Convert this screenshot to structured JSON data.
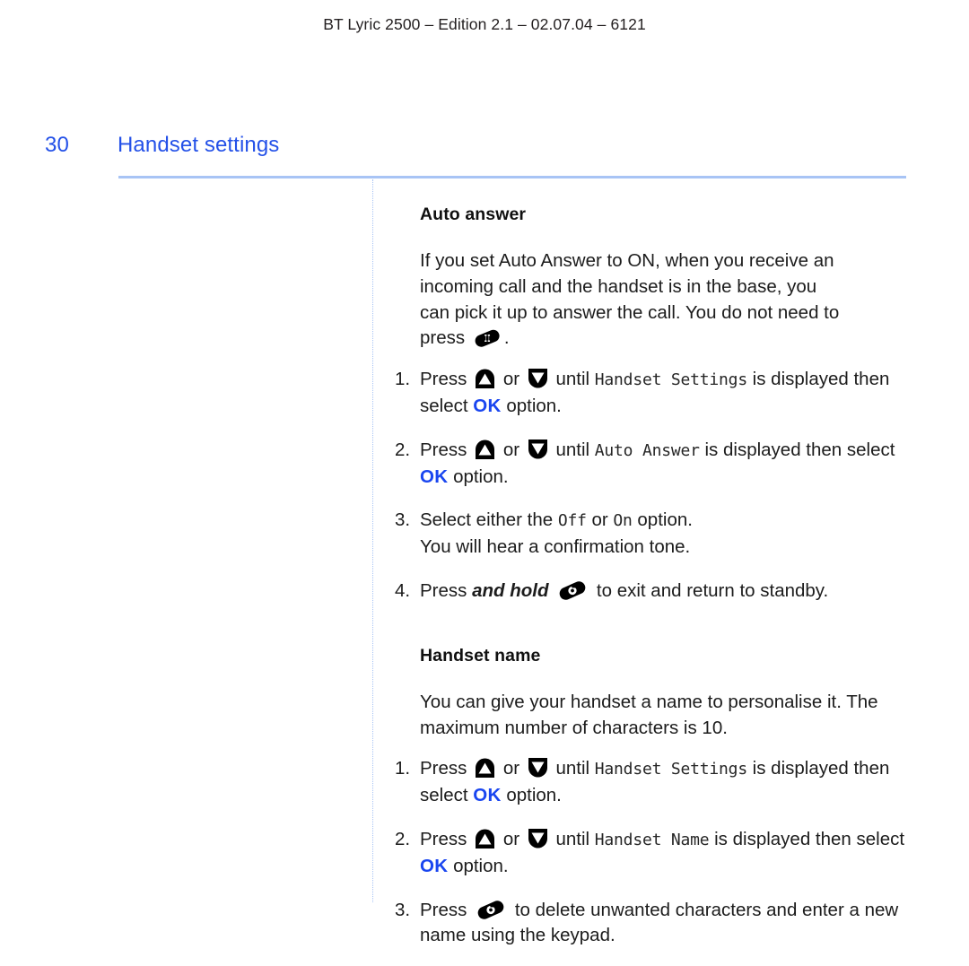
{
  "header": {
    "running_head": "BT Lyric 2500 – Edition 2.1 – 02.07.04 – 6121"
  },
  "page": {
    "number": "30",
    "section_title": "Handset settings",
    "accent_blue": "#2451e8",
    "rule_blue": "#a8c4f5",
    "ok_blue": "#1a46f0"
  },
  "sections": [
    {
      "heading": "Auto answer",
      "intro_line1": "If you set Auto Answer to ON, when you receive an",
      "intro_line2": "incoming call and the handset is in the base, you",
      "intro_line3": "can pick it up to answer the call.  You do not need to",
      "intro_line4_pre": "press",
      "intro_line4_post": ".",
      "steps": [
        {
          "num": "1.",
          "pre": "Press",
          "mid": "or",
          "post_icons": "until",
          "lcd": "Handset Settings",
          "after_lcd": "is displayed then select",
          "ok": "OK",
          "tail": "option."
        },
        {
          "num": "2.",
          "pre": "Press",
          "mid": "or",
          "post_icons": "until",
          "lcd": "Auto  Answer",
          "after_lcd": "is displayed then select",
          "ok": "OK",
          "tail": "option."
        },
        {
          "num": "3.",
          "pre": "Select either the",
          "lcd_off": "Off",
          "mid": "or",
          "lcd_on": "On",
          "after_lcd": "option.",
          "line2": "You will hear a confirmation tone."
        },
        {
          "num": "4.",
          "pre": "Press",
          "bold_italic": "and hold",
          "tail": "to exit and return to standby."
        }
      ]
    },
    {
      "heading": "Handset name",
      "intro_line1": "You can give your handset a name to personalise it. The",
      "intro_line2": "maximum number of characters is 10.",
      "steps": [
        {
          "num": "1.",
          "pre": "Press",
          "mid": "or",
          "post_icons": "until",
          "lcd": "Handset  Settings",
          "after_lcd": "is displayed then select",
          "ok": "OK",
          "tail": "option."
        },
        {
          "num": "2.",
          "pre": "Press",
          "mid": "or",
          "post_icons": "until",
          "lcd": "Handset  Name",
          "after_lcd": "is displayed then select",
          "ok": "OK",
          "tail": "option."
        },
        {
          "num": "3.",
          "pre": "Press",
          "tail": "to delete unwanted characters and enter a new name using the keypad."
        }
      ]
    }
  ],
  "icons": {
    "talk_key": "talk-key-icon",
    "end_key": "end-call-key-icon",
    "up_key": "nav-up-key-icon",
    "down_key": "nav-down-key-icon"
  }
}
